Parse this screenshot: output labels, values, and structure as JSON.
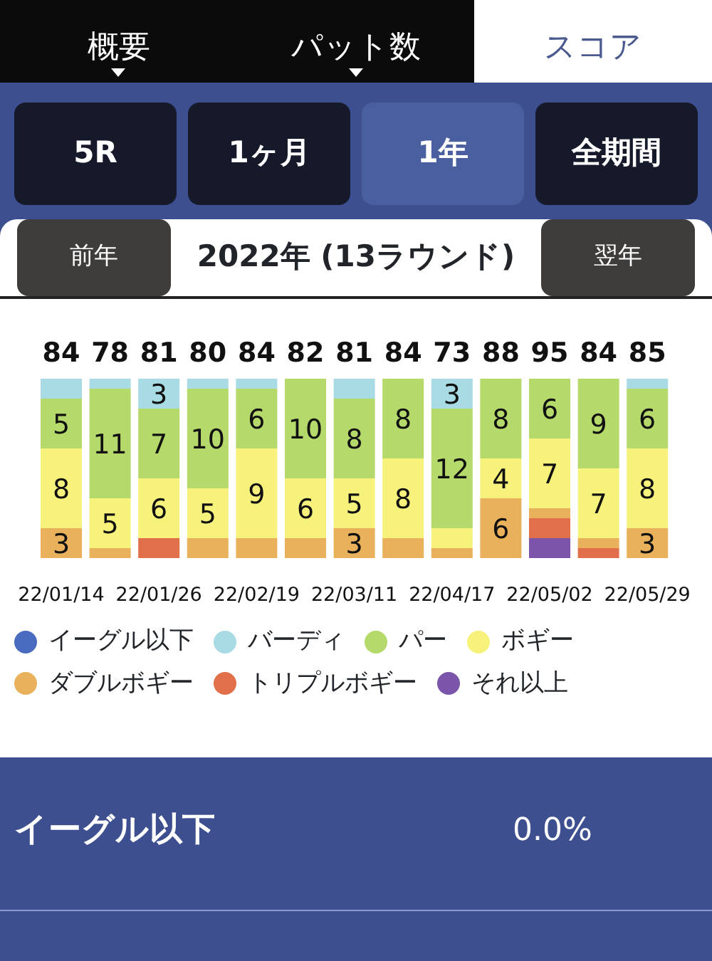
{
  "tabs": [
    {
      "label": "概要",
      "selected": false
    },
    {
      "label": "パット数",
      "selected": false
    },
    {
      "label": "スコア",
      "selected": true
    }
  ],
  "periods": [
    {
      "label": "5R",
      "selected": false
    },
    {
      "label": "1ヶ月",
      "selected": false
    },
    {
      "label": "1年",
      "selected": true
    },
    {
      "label": "全期間",
      "selected": false
    }
  ],
  "year_nav": {
    "prev": "前年",
    "title": "2022年 (13ラウンド)",
    "next": "翌年"
  },
  "chart_data": {
    "type": "bar",
    "stacked": true,
    "categories": [
      "22/01/14",
      null,
      "22/01/26",
      null,
      "22/02/19",
      null,
      "22/03/11",
      null,
      "22/04/17",
      null,
      "22/05/02",
      null,
      "22/05/29"
    ],
    "series": [
      {
        "name": "それ以上",
        "color": "#7b55aa",
        "values": [
          0,
          0,
          0,
          0,
          0,
          0,
          0,
          0,
          0,
          0,
          2,
          0,
          0
        ],
        "value_labels": [
          null,
          null,
          null,
          null,
          null,
          null,
          null,
          null,
          null,
          null,
          null,
          null,
          null
        ]
      },
      {
        "name": "トリプルボギー",
        "color": "#e1704a",
        "values": [
          0,
          0,
          2,
          0,
          0,
          0,
          0,
          0,
          0,
          0,
          2,
          1,
          0
        ],
        "value_labels": [
          null,
          null,
          null,
          null,
          null,
          null,
          null,
          null,
          null,
          null,
          null,
          null,
          null
        ]
      },
      {
        "name": "ダブルボギー",
        "color": "#e9b15b",
        "values": [
          3,
          1,
          0,
          2,
          2,
          2,
          3,
          2,
          1,
          6,
          1,
          1,
          3
        ],
        "value_labels": [
          "3",
          null,
          null,
          null,
          null,
          null,
          "3",
          null,
          null,
          "6",
          null,
          null,
          "3"
        ]
      },
      {
        "name": "ボギー",
        "color": "#f7f27c",
        "values": [
          8,
          5,
          6,
          5,
          9,
          6,
          5,
          8,
          2,
          4,
          7,
          7,
          8
        ],
        "value_labels": [
          "8",
          "5",
          "6",
          "5",
          "9",
          "6",
          "5",
          "8",
          null,
          "4",
          "7",
          "7",
          "8"
        ]
      },
      {
        "name": "パー",
        "color": "#b5d96a",
        "values": [
          5,
          11,
          7,
          10,
          6,
          10,
          8,
          8,
          12,
          8,
          6,
          9,
          6
        ],
        "value_labels": [
          "5",
          "11",
          "7",
          "10",
          "6",
          "10",
          "8",
          "8",
          "12",
          "8",
          "6",
          "9",
          "6"
        ]
      },
      {
        "name": "バーディ",
        "color": "#a8dbe3",
        "values": [
          2,
          1,
          3,
          1,
          1,
          0,
          2,
          0,
          3,
          0,
          0,
          0,
          1
        ],
        "value_labels": [
          null,
          null,
          "3",
          null,
          null,
          null,
          null,
          null,
          "3",
          null,
          null,
          null,
          null
        ]
      },
      {
        "name": "イーグル以下",
        "color": "#4a6cc0",
        "values": [
          0,
          0,
          0,
          0,
          0,
          0,
          0,
          0,
          0,
          0,
          0,
          0,
          0
        ],
        "value_labels": [
          null,
          null,
          null,
          null,
          null,
          null,
          null,
          null,
          null,
          null,
          null,
          null,
          null
        ]
      }
    ],
    "annotations": [
      "84",
      "78",
      "81",
      "80",
      "84",
      "82",
      "81",
      "84",
      "73",
      "88",
      "95",
      "84",
      "85"
    ]
  },
  "stats": [
    {
      "label": "イーグル以下",
      "value": "0.0%"
    }
  ]
}
